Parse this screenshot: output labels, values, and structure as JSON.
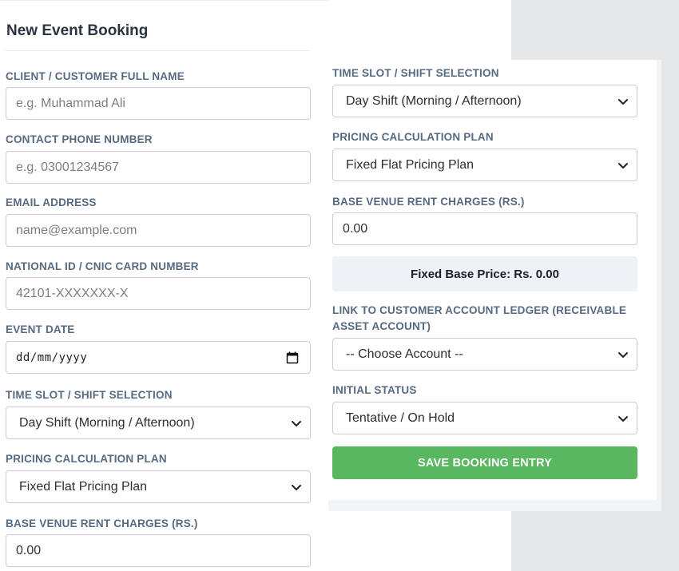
{
  "form": {
    "title": "New Event Booking",
    "left": {
      "client_name": {
        "label": "CLIENT / CUSTOMER FULL NAME",
        "placeholder": "e.g. Muhammad Ali"
      },
      "phone": {
        "label": "CONTACT PHONE NUMBER",
        "placeholder": "e.g. 03001234567"
      },
      "email": {
        "label": "EMAIL ADDRESS",
        "placeholder": "name@example.com"
      },
      "cnic": {
        "label": "NATIONAL ID / CNIC CARD NUMBER",
        "placeholder": "42101-XXXXXXX-X"
      },
      "event_date": {
        "label": "EVENT DATE",
        "mask": "dd/mm/yyyy"
      },
      "time_slot": {
        "label": "TIME SLOT / SHIFT SELECTION",
        "value": "Day Shift (Morning / Afternoon)"
      },
      "pricing_plan": {
        "label": "PRICING CALCULATION PLAN",
        "value": "Fixed Flat Pricing Plan"
      },
      "base_rent": {
        "label": "BASE VENUE RENT CHARGES (RS.)",
        "value": "0.00"
      }
    },
    "right": {
      "time_slot": {
        "label": "TIME SLOT / SHIFT SELECTION",
        "value": "Day Shift (Morning / Afternoon)"
      },
      "pricing_plan": {
        "label": "PRICING CALCULATION PLAN",
        "value": "Fixed Flat Pricing Plan"
      },
      "base_rent": {
        "label": "BASE VENUE RENT CHARGES (RS.)",
        "value": "0.00"
      },
      "fixed_price_summary": "Fixed Base Price: Rs. 0.00",
      "ledger": {
        "label_line1": "LINK TO CUSTOMER ACCOUNT LEDGER (RECEIVABLE",
        "label_line2": "ASSET ACCOUNT)",
        "value": "-- Choose Account --"
      },
      "status": {
        "label": "INITIAL STATUS",
        "value": "Tentative / On Hold"
      },
      "save_label": "SAVE BOOKING ENTRY"
    }
  },
  "icons": {
    "select_arrow": "chevron-down-icon",
    "date_picker": "calendar-icon"
  },
  "colors": {
    "label": "#566a82",
    "save_button": "#59b85f",
    "price_box": "#eef1f5",
    "side_background": "#e6e7e9"
  }
}
